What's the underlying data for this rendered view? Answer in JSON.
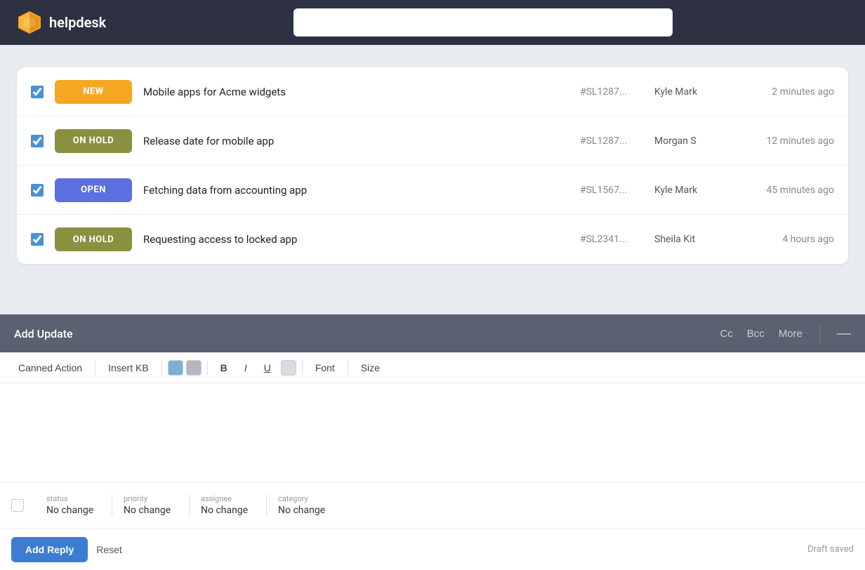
{
  "header": {
    "logo_text": "helpdesk",
    "search_placeholder": ""
  },
  "tickets": [
    {
      "id": 1,
      "status": "NEW",
      "status_class": "badge-new",
      "subject": "Mobile apps for Acme widgets",
      "ticket_id": "#SL1287...",
      "agent": "Kyle Mark",
      "time": "2 minutes ago",
      "checked": true
    },
    {
      "id": 2,
      "status": "ON HOLD",
      "status_class": "badge-onhold",
      "subject": "Release date for mobile app",
      "ticket_id": "#SL1287...",
      "agent": "Morgan S",
      "time": "12 minutes ago",
      "checked": true
    },
    {
      "id": 3,
      "status": "OPEN",
      "status_class": "badge-open",
      "subject": "Fetching data from accounting app",
      "ticket_id": "#SL1567...",
      "agent": "Kyle Mark",
      "time": "45 minutes ago",
      "checked": true
    },
    {
      "id": 4,
      "status": "ON HOLD",
      "status_class": "badge-onhold",
      "subject": "Requesting access to locked app",
      "ticket_id": "#SL2341...",
      "agent": "Sheila Kit",
      "time": "4 hours ago",
      "checked": true
    }
  ],
  "add_update": {
    "title": "Add Update",
    "cc_label": "Cc",
    "bcc_label": "Bcc",
    "more_label": "More",
    "minimize_icon": "—"
  },
  "toolbar": {
    "canned_action": "Canned Action",
    "insert_kb": "Insert KB",
    "bold": "B",
    "italic": "I",
    "underline": "U",
    "font": "Font",
    "size": "Size"
  },
  "footer": {
    "status_label": "status",
    "status_value": "No change",
    "priority_label": "priority",
    "priority_value": "No change",
    "assignee_label": "assignee",
    "assignee_value": "No change",
    "category_label": "category",
    "category_value": "No change"
  },
  "actions": {
    "add_reply": "Add Reply",
    "reset": "Reset",
    "draft_saved": "Draft saved"
  }
}
